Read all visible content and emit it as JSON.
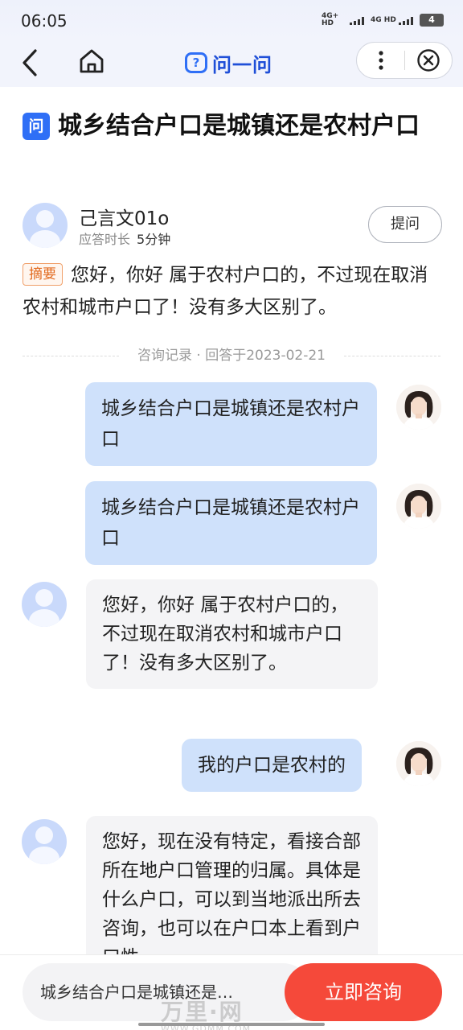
{
  "status": {
    "time": "06:05",
    "network1": "4G+ HD",
    "network2": "4G HD",
    "battery": "4"
  },
  "nav": {
    "logo_text": "问一问",
    "logo_glyph": "?"
  },
  "question": {
    "badge": "问",
    "title": "城乡结合户口是城镇还是农村户口"
  },
  "author": {
    "name": "己言文01o",
    "meta_label": "应答时长",
    "meta_value": "5分钟",
    "ask_label": "提问"
  },
  "summary": {
    "tag": "摘要",
    "text": "您好，你好 属于农村户口的，不过现在取消农村和城市户口了！没有多大区别了。"
  },
  "record": {
    "label": "咨询记录 · 回答于2023-02-21"
  },
  "messages": [
    {
      "side": "user",
      "text": "城乡结合户口是城镇还是农村户口"
    },
    {
      "side": "user",
      "text": "城乡结合户口是城镇还是农村户口"
    },
    {
      "side": "expert",
      "text": "您好，你好 属于农村户口的，不过现在取消农村和城市户口了！没有多大区别了。"
    },
    {
      "side": "user",
      "text": "我的户口是农村的"
    },
    {
      "side": "expert",
      "text": "您好，现在没有特定，看接合部所在地户口管理的归属。具体是什么户口，可以到当地派出所去咨询，也可以在户口本上看到户口性"
    }
  ],
  "bottom": {
    "input_text": "城乡结合户口是城镇还是…",
    "consult_label": "立即咨询"
  },
  "watermark": {
    "main": "万里·网",
    "sub": "WWW.GDMM.COM"
  },
  "colors": {
    "accent_blue": "#2f6ff6",
    "bubble_user": "#cfe1fb",
    "bubble_expert": "#f4f4f6",
    "consult_red": "#f5493a",
    "summary_orange": "#e26a1f"
  }
}
